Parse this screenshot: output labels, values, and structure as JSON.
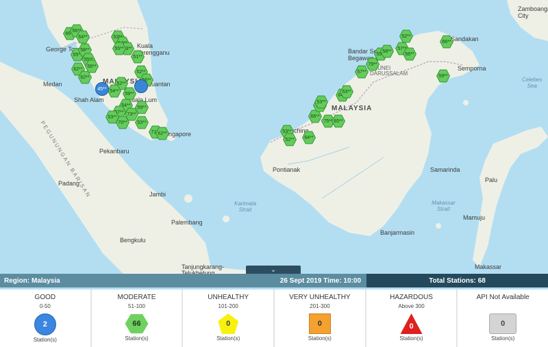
{
  "map": {
    "labels": {
      "kuala_terengganu": "Kuala\nTerengganu",
      "george_town": "George Town",
      "medan": "Medan",
      "shah_alam": "Shah Alam",
      "kuantan": "Kuantan",
      "kuala_lumpur": "Kuala Lum",
      "singapore": "Singapore",
      "pekanbaru": "Pekanbaru",
      "padang": "Padang",
      "jambi": "Jambi",
      "palembang": "Palembang",
      "bengkulu": "Bengkulu",
      "tanjungkarang": "Tanjungkarang-\nTelukbetung",
      "malaysia_west": "MALAYSIA",
      "malaysia_east": "MALAYSIA",
      "brunei": "BRUNEI\nDARUSSALAM",
      "bandar_seri_begawan": "Bandar Seri\nBegawan",
      "kuching": "Kuching",
      "pontianak": "Pontianak",
      "samarinda": "Samarinda",
      "banjarmasin": "Banjarmasin",
      "sandakan": "Sandakan",
      "semporna": "Semporna",
      "palu": "Palu",
      "mamuju": "Mamuju",
      "makassar": "Makassar",
      "zamboanga": "Zamboanga\nCity",
      "celebes_sea": "Celebes\nSea",
      "karimata_strait": "Karimata\nStrait",
      "makassar_strait": "Makassar\nStrait",
      "pegunungan": "PEGUNUNGAN BARISAN"
    },
    "stations": [
      {
        "label": "66**"
      },
      {
        "label": "56**"
      },
      {
        "label": "64**"
      },
      {
        "label": "55**"
      },
      {
        "label": "58**"
      },
      {
        "label": "55**"
      },
      {
        "label": "62**"
      },
      {
        "label": "62**"
      },
      {
        "label": "56**"
      },
      {
        "label": "53**"
      },
      {
        "label": "54**"
      },
      {
        "label": "53**"
      },
      {
        "label": "55**"
      },
      {
        "label": "51**"
      },
      {
        "label": "52**"
      },
      {
        "label": "56**"
      },
      {
        "label": "52**"
      },
      {
        "label": "59**"
      },
      {
        "label": "54**"
      },
      {
        "label": "54**"
      },
      {
        "label": "57**"
      },
      {
        "label": "73**"
      },
      {
        "label": "53**"
      },
      {
        "label": "59**"
      },
      {
        "label": "53**"
      },
      {
        "label": "70**"
      },
      {
        "label": "71**"
      },
      {
        "label": "62**"
      },
      {
        "label": "53**"
      },
      {
        "label": "52**"
      },
      {
        "label": "64**"
      },
      {
        "label": "66**"
      },
      {
        "label": "73**"
      },
      {
        "label": "75**"
      },
      {
        "label": "65**"
      },
      {
        "label": "53**"
      },
      {
        "label": "64**"
      },
      {
        "label": "53**"
      },
      {
        "label": "57**"
      },
      {
        "label": "79**"
      },
      {
        "label": "55**"
      },
      {
        "label": "58**"
      },
      {
        "label": "57**"
      },
      {
        "label": "52**"
      },
      {
        "label": "56**"
      },
      {
        "label": "59**"
      },
      {
        "label": "66**"
      }
    ],
    "good_station_label": "45**"
  },
  "toggle_icon": "chevron-down",
  "status_bar": {
    "region": "Region: Malaysia",
    "datetime": "26 Sept 2019   Time: 10:00",
    "total": "Total Stations: 68"
  },
  "categories": [
    {
      "title": "GOOD",
      "range": "0-50",
      "count": "2",
      "unit": "Station(s)",
      "color": "#3a86e0"
    },
    {
      "title": "MODERATE",
      "range": "51-100",
      "count": "66",
      "unit": "Station(s)",
      "color": "#6fd15f"
    },
    {
      "title": "UNHEALTHY",
      "range": "101-200",
      "count": "0",
      "unit": "Station(s)",
      "color": "#f7f10f"
    },
    {
      "title": "VERY UNHEALTHY",
      "range": "201-300",
      "count": "0",
      "unit": "Station(s)",
      "color": "#f5a130"
    },
    {
      "title": "HAZARDOUS",
      "range": "Above 300",
      "count": "0",
      "unit": "Station(s)",
      "color": "#e01f1f"
    },
    {
      "title": "API Not Available",
      "range": "",
      "count": "0",
      "unit": "Station(s)",
      "color": "#d4d4d4"
    }
  ]
}
